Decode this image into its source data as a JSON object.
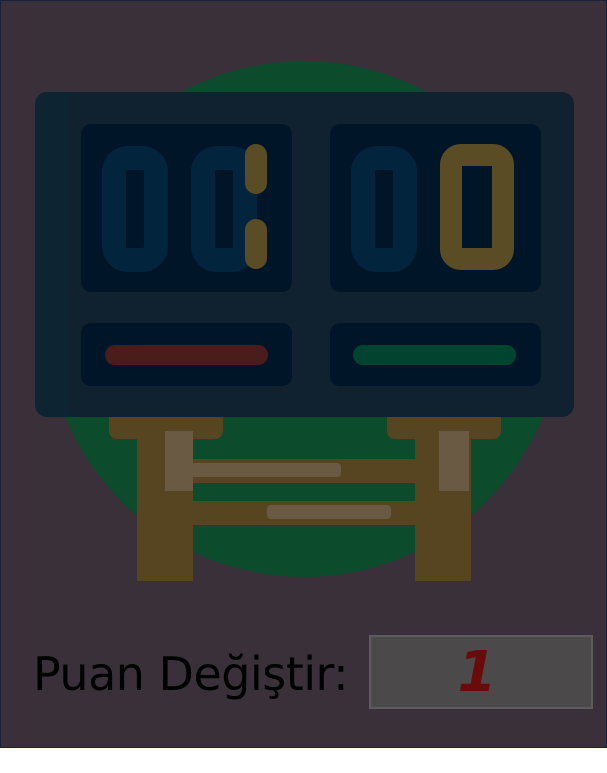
{
  "scoreboard": {
    "illustration_icon": "scoreboard-icon",
    "colors": {
      "background": "#393039",
      "circle": "#0c4b2b",
      "board": "#10222f",
      "panel": "#001628",
      "digit_off": "#02253d",
      "digit_on": "#5a4d26",
      "bar_left": "#4b1c1c",
      "bar_right": "#00432f",
      "stand": "#574521"
    }
  },
  "score_control": {
    "label": "Puan Değiştir:",
    "value": "1"
  }
}
